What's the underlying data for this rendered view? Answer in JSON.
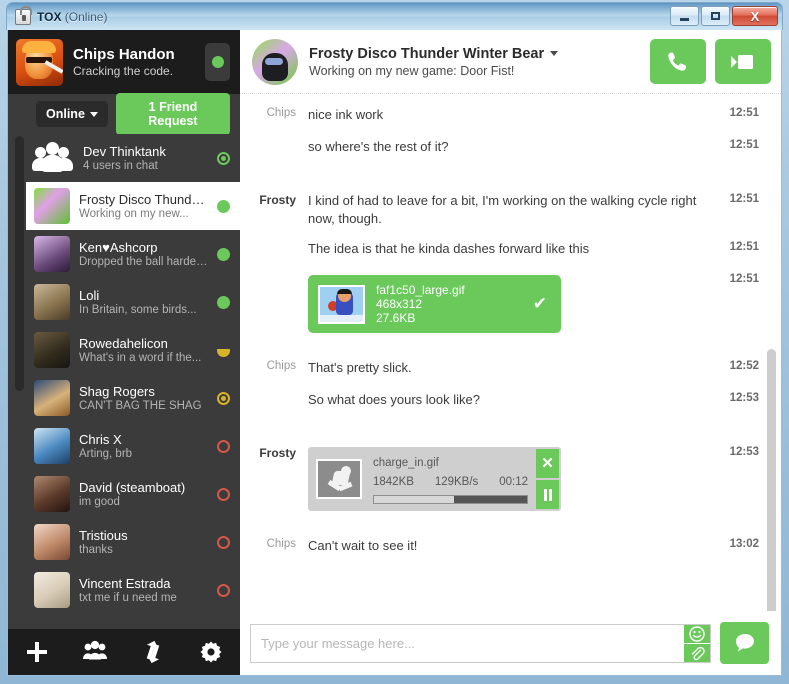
{
  "window": {
    "title": "TOX",
    "title_suffix": "(Online)",
    "minimize_label": "Minimize",
    "maximize_label": "Maximize",
    "close_label": "X"
  },
  "profile": {
    "name": "Chips Handon",
    "status_message": "Cracking the code.",
    "status": "online"
  },
  "filters": {
    "status_select_label": "Online",
    "friend_request_label": "1 Friend Request"
  },
  "friends": [
    {
      "name": "Dev Thinktank",
      "sub": "4 users in chat",
      "status": "group",
      "selected": false,
      "kind": "group"
    },
    {
      "name": "Frosty Disco Thunder...",
      "sub": "Working on my new...",
      "status": "online",
      "selected": true,
      "kind": "friend"
    },
    {
      "name": "Ken♥Ashcorp",
      "sub": "Dropped the ball harder...",
      "status": "online",
      "selected": false,
      "kind": "friend"
    },
    {
      "name": "Loli",
      "sub": "In Britain, some birds...",
      "status": "online",
      "selected": false,
      "kind": "friend"
    },
    {
      "name": "Rowedahelicon",
      "sub": "What's in a word if the...",
      "status": "away",
      "selected": false,
      "kind": "friend"
    },
    {
      "name": "Shag Rogers",
      "sub": "CAN'T BAG THE SHAG",
      "status": "away-ring",
      "selected": false,
      "kind": "friend"
    },
    {
      "name": "Chris X",
      "sub": "Arting, brb",
      "status": "offline",
      "selected": false,
      "kind": "friend"
    },
    {
      "name": "David (steamboat)",
      "sub": "im good",
      "status": "offline",
      "selected": false,
      "kind": "friend"
    },
    {
      "name": "Tristious",
      "sub": "thanks",
      "status": "offline",
      "selected": false,
      "kind": "friend"
    },
    {
      "name": "Vincent Estrada",
      "sub": "txt me if u need me",
      "status": "offline",
      "selected": false,
      "kind": "friend"
    }
  ],
  "toolbar": {
    "add_friend_label": "add-friend",
    "create_group_label": "create-group",
    "transfers_label": "file-transfers",
    "settings_label": "settings"
  },
  "chat_header": {
    "name": "Frosty Disco Thunder Winter Bear",
    "status_message": "Working on my new game: Door Fist!",
    "call_label": "audio-call",
    "video_label": "video-call"
  },
  "messages": [
    {
      "author": "Chips",
      "author_bold": false,
      "text": "nice ink work",
      "time": "12:51",
      "type": "text"
    },
    {
      "author": "",
      "author_bold": false,
      "text": "so where's the rest of it?",
      "time": "12:51",
      "type": "text"
    },
    {
      "author": "Frosty",
      "author_bold": true,
      "text": "I kind of had to leave for a bit, I'm working on the walking cycle right now, though.",
      "time": "12:51",
      "type": "text"
    },
    {
      "author": "",
      "author_bold": false,
      "text": "The idea is that he kinda dashes forward like this",
      "time": "12:51",
      "type": "text"
    },
    {
      "author": "",
      "author_bold": false,
      "text": "",
      "time": "12:51",
      "type": "file_done"
    },
    {
      "author": "Chips",
      "author_bold": false,
      "text": "That's pretty slick.",
      "time": "12:52",
      "type": "text"
    },
    {
      "author": "",
      "author_bold": false,
      "text": "So what does yours look like?",
      "time": "12:53",
      "type": "text"
    },
    {
      "author": "Frosty",
      "author_bold": true,
      "text": "",
      "time": "12:53",
      "type": "file_transfer"
    },
    {
      "author": "Chips",
      "author_bold": false,
      "text": "Can't wait to see it!",
      "time": "13:02",
      "type": "text"
    }
  ],
  "file_done": {
    "filename": "faf1c50_large.gif",
    "dimensions": "468x312",
    "filesize": "27.6KB",
    "check_glyph": "✔"
  },
  "file_transfer": {
    "filename": "charge_in.gif",
    "filesize": "1842KB",
    "speed": "129KB/s",
    "eta": "00:12",
    "progress_percent": 52,
    "cancel_glyph": "✕",
    "pause_label": "pause"
  },
  "composer": {
    "placeholder": "Type your message here...",
    "value": "",
    "emoji_label": "emoji",
    "attach_label": "attach-file",
    "send_label": "send"
  },
  "colors": {
    "accent_green": "#6bc95b",
    "sidebar_bg": "#3b3b3b",
    "sidebar_dark": "#1c1c1c",
    "away_yellow": "#d9b429",
    "offline_red": "#d9554a"
  }
}
